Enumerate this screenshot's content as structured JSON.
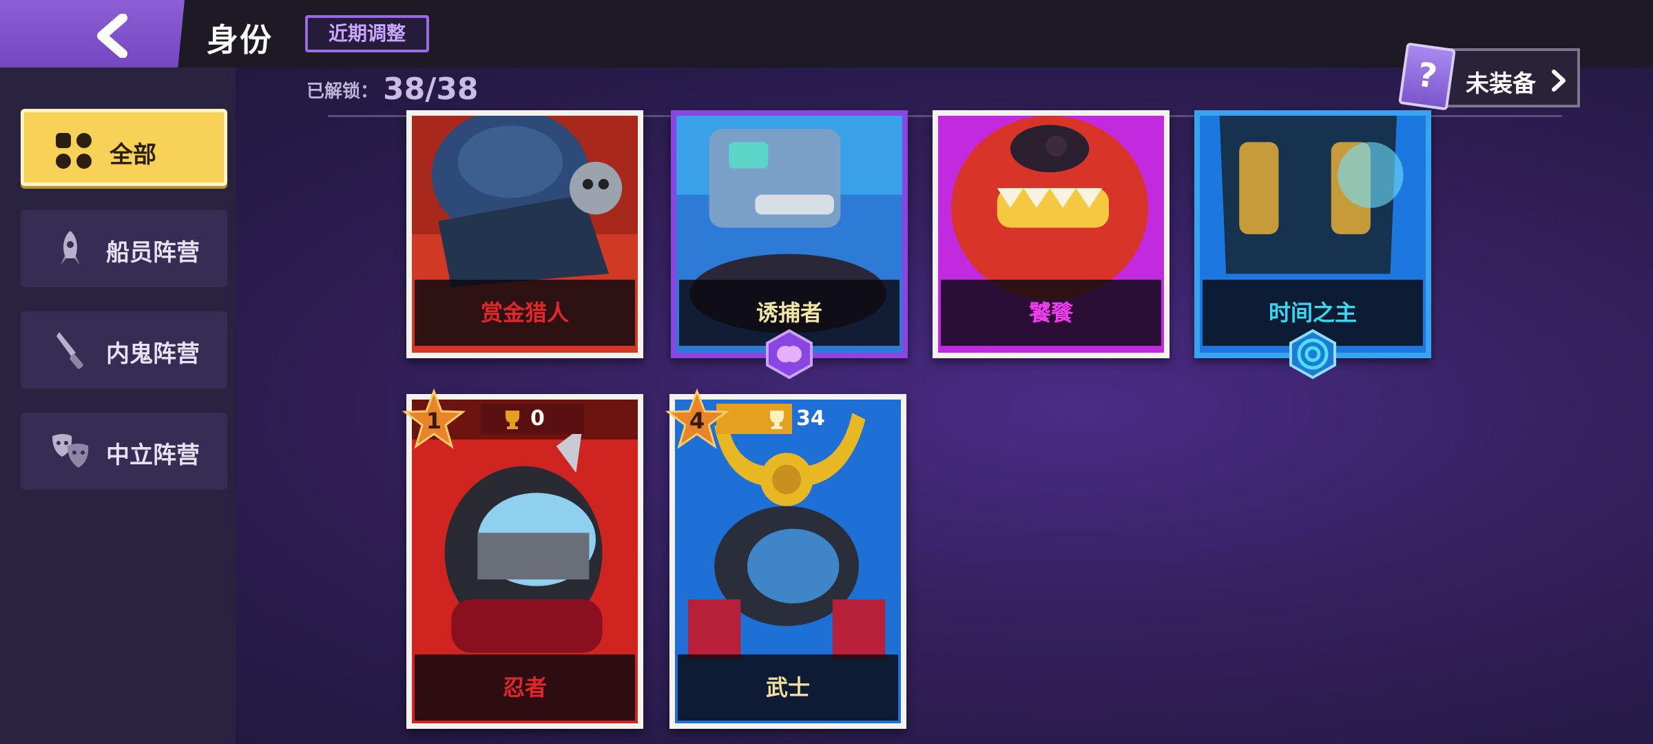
{
  "header": {
    "title": "身份",
    "recent_badge": "近期调整"
  },
  "unlocked": {
    "label": "已解锁：",
    "value": "38/38"
  },
  "unequipped_button": {
    "label": "未装备",
    "icon": "question-card-icon"
  },
  "sidebar": {
    "items": [
      {
        "label": "全部",
        "icon": "grid-icon",
        "active": true
      },
      {
        "label": "船员阵营",
        "icon": "rocket-icon",
        "active": false
      },
      {
        "label": "内鬼阵营",
        "icon": "knife-icon",
        "active": false
      },
      {
        "label": "中立阵营",
        "icon": "masks-icon",
        "active": false
      }
    ]
  },
  "cards": [
    {
      "name": "赏金猎人",
      "name_color": "#e2262a",
      "frame": "white"
    },
    {
      "name": "诱捕者",
      "name_color": "#f2e7a8",
      "frame": "purple",
      "emblem": "brain-icon"
    },
    {
      "name": "饕餮",
      "name_color": "#f23cf2",
      "frame": "white"
    },
    {
      "name": "时间之主",
      "name_color": "#3ad6f2",
      "frame": "blue",
      "emblem": "spiral-icon"
    },
    {
      "name": "忍者",
      "name_color": "#e2262a",
      "frame": "white",
      "rank": "1",
      "trophies": "0"
    },
    {
      "name": "武士",
      "name_color": "#f2dfa0",
      "frame": "white",
      "rank": "4",
      "trophies": "34"
    }
  ],
  "colors": {
    "accent_active": "#f7d256",
    "crew_red": "#e2262a",
    "neutral_cyan": "#3ad6f2",
    "impostor_purple": "#8a46e0"
  }
}
